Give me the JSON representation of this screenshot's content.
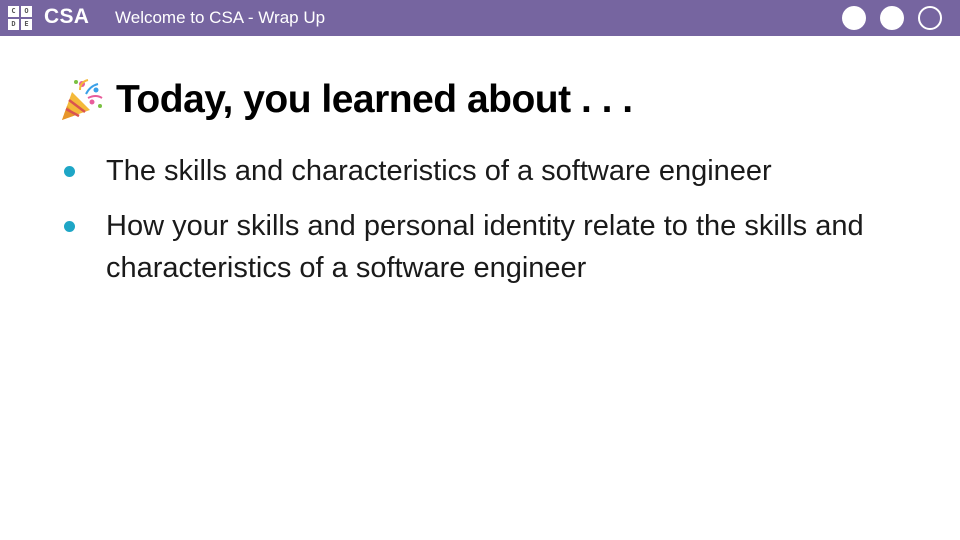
{
  "topbar": {
    "logo_letters": [
      "C",
      "O",
      "D",
      "E"
    ],
    "brand": "CSA",
    "title": "Welcome to CSA - Wrap Up",
    "background_color": "#7665a0"
  },
  "slide": {
    "heading_icon": "party-popper-icon",
    "heading": "Today, you learned about . . .",
    "bullet_color": "#1ea6c6",
    "bullets": [
      "The skills and characteristics of a software engineer",
      "How your skills and personal identity relate to the skills and characteristics of a software engineer"
    ]
  }
}
